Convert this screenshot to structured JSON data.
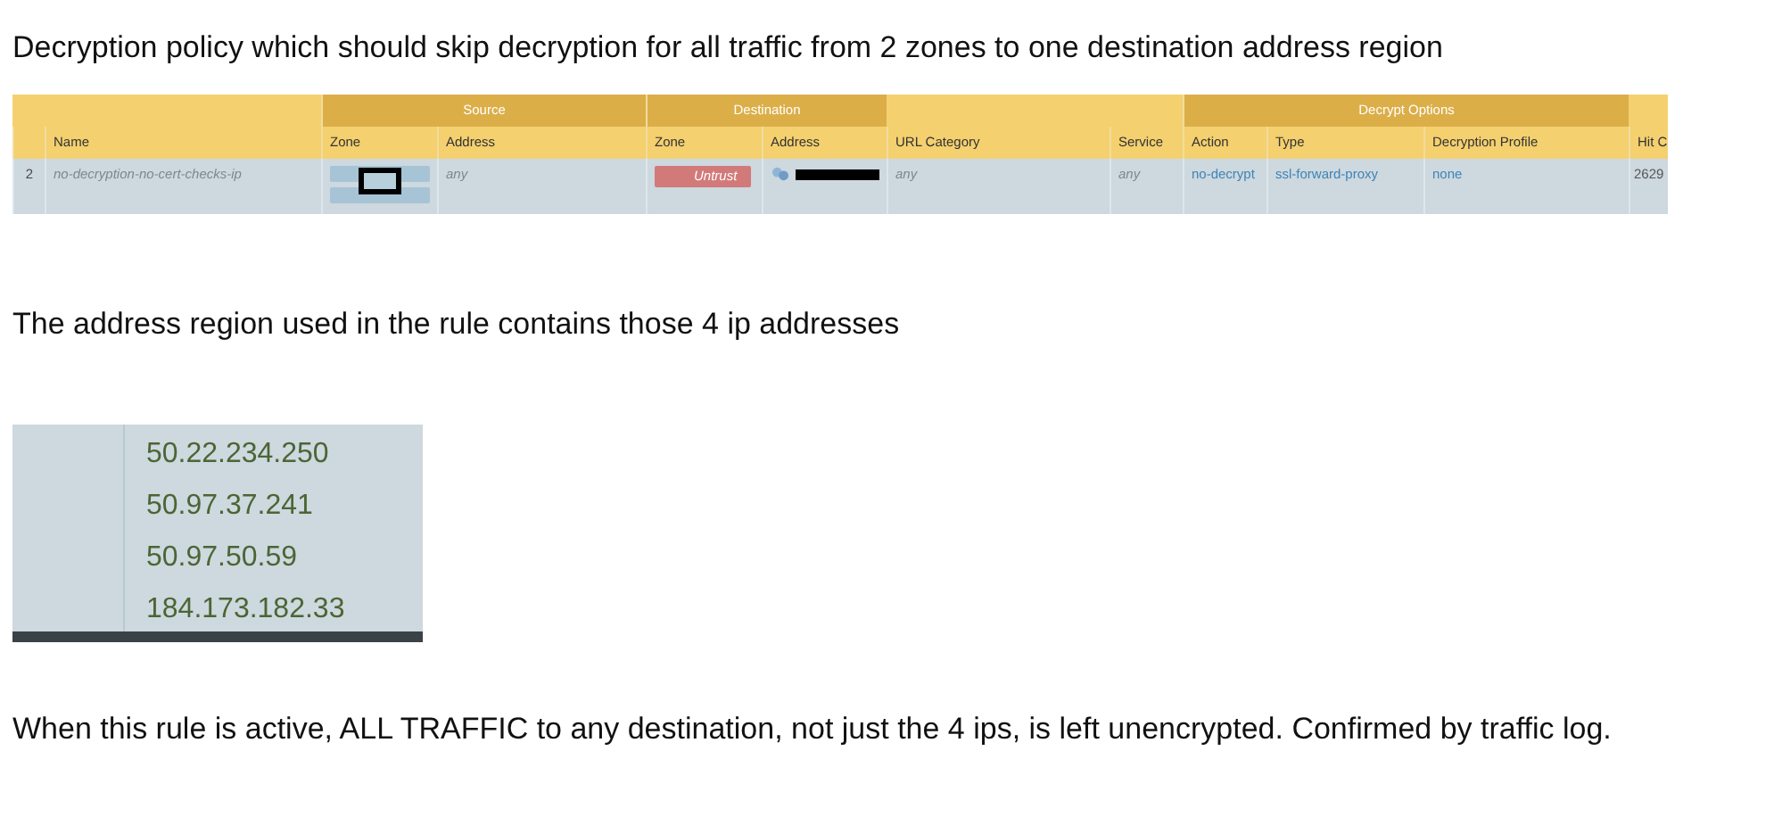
{
  "intro": "Decryption policy which should skip decryption for all traffic from 2 zones to one destination address region",
  "table": {
    "groups": [
      "Source",
      "Destination",
      "Decrypt Options"
    ],
    "columns": [
      "",
      "Name",
      "Zone",
      "Address",
      "Zone",
      "Address",
      "URL Category",
      "Service",
      "Action",
      "Type",
      "Decryption Profile",
      "Hit C"
    ],
    "rows": [
      {
        "index": "2",
        "name": "no-decryption-no-cert-checks-ip",
        "source_address": "any",
        "destination_zone": "Untrust",
        "url_category": "any",
        "service": "any",
        "action": "no-decrypt",
        "type": "ssl-forward-proxy",
        "profile": "none",
        "hit_count": "2629"
      }
    ]
  },
  "middle": "The address region used in the rule contains those 4 ip addresses",
  "addresses": [
    "50.22.234.250",
    "50.97.37.241",
    "50.97.50.59",
    "184.173.182.33"
  ],
  "outro": "When this rule is active, ALL TRAFFIC to any destination, not just the 4 ips, is left unencrypted. Confirmed by traffic log."
}
